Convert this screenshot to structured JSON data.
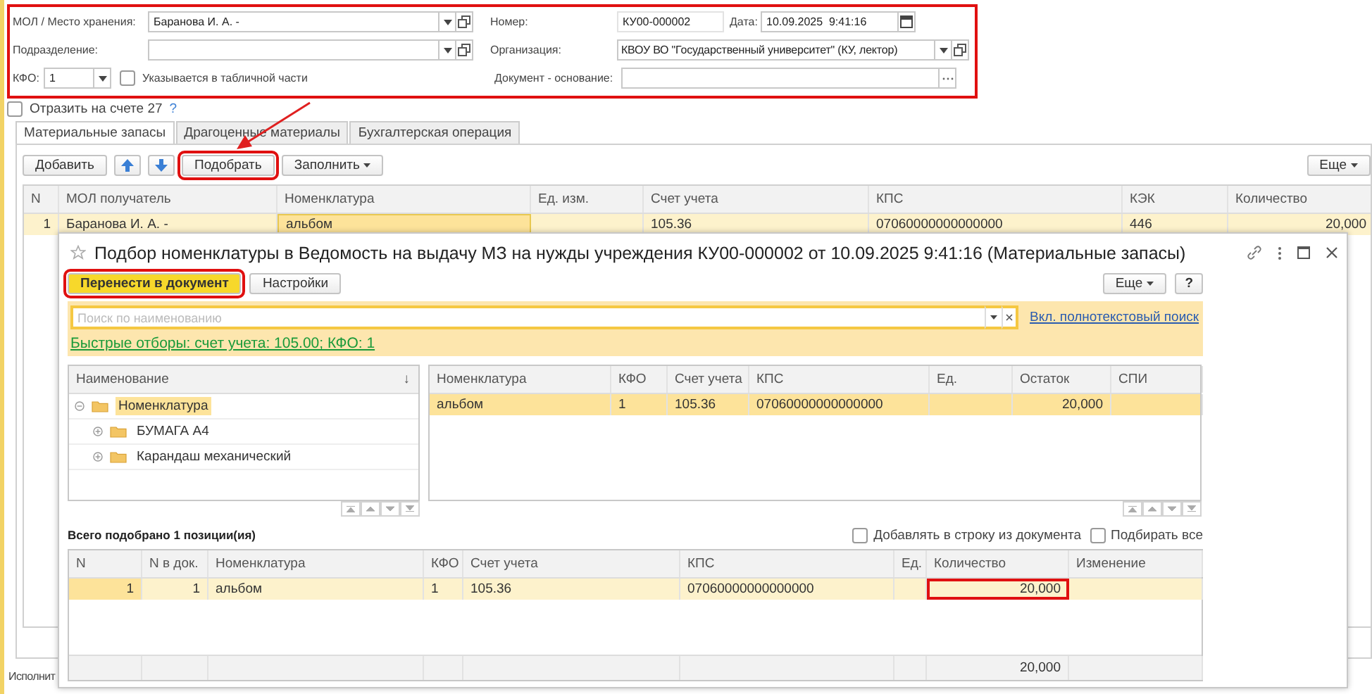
{
  "header": {
    "annotated": true,
    "mol": {
      "label": "МОЛ / Место хранения:",
      "value": "Баранова И. А. -"
    },
    "number": {
      "label": "Номер:",
      "value": "КУ00-000002"
    },
    "date": {
      "label": "Дата:",
      "value": "10.09.2025  9:41:16"
    },
    "department": {
      "label": "Подразделение:"
    },
    "organization": {
      "label": "Организация:",
      "value": "КВОУ ВО \"Государственный университет\" (КУ, лектор)"
    },
    "kfo": {
      "label": "КФО:",
      "value": "1"
    },
    "in_table": {
      "label": "Указывается в табличной части",
      "checked": false
    },
    "basis": {
      "label": "Документ - основание:"
    }
  },
  "account27": {
    "label": "Отразить на счете 27",
    "checked": false,
    "help": "?"
  },
  "tabs": [
    {
      "label": "Материальные запасы",
      "selected": true
    },
    {
      "label": "Драгоценные материалы",
      "selected": false
    },
    {
      "label": "Бухгалтерская операция",
      "selected": false
    }
  ],
  "toolbar": {
    "buttons": [
      {
        "kind": "text",
        "label": "Добавить",
        "annotated": false
      },
      {
        "kind": "up"
      },
      {
        "kind": "down"
      },
      {
        "kind": "text",
        "label": "Подобрать",
        "annotated": true
      },
      {
        "kind": "dropdown",
        "label": "Заполнить",
        "annotated": false
      }
    ],
    "more": "Еще"
  },
  "table": {
    "columns": [
      "N",
      "МОЛ получатель",
      "Номенклатура",
      "Ед. изм.",
      "Счет учета",
      "КПС",
      "КЭК",
      "Количество"
    ],
    "rows": [
      {
        "selected": true,
        "focused": [
          false,
          false,
          true,
          false,
          false,
          false,
          false,
          false
        ],
        "cells": [
          "1",
          "Баранова И. А. -",
          "альбом",
          null,
          "105.36",
          "07060000000000000",
          "446",
          "20,000"
        ]
      }
    ]
  },
  "footer_label": "Исполнит",
  "dialog": {
    "title": "Подбор номенклатуры в Ведомость на выдачу МЗ на нужды учреждения КУ00-000002 от 10.09.2025 9:41:16 (Материальные запасы)",
    "buttons": [
      {
        "label": "Перенести в документ",
        "default": true,
        "annotated": true
      },
      {
        "label": "Настройки",
        "default": false,
        "annotated": false
      }
    ],
    "more": "Еще",
    "help": "?",
    "search": {
      "placeholder": "Поиск по наименованию"
    },
    "fulltext_link": "Вкл. полнотекстовый поиск",
    "quick_filter": "Быстрые отборы: счет учета: 105.00; КФО: 1",
    "tree": {
      "column": "Наименование",
      "sort": "↓",
      "items": [
        {
          "label": "Номенклатура",
          "expanded": true,
          "selected": true,
          "children": [
            {
              "label": "БУМАГА А4",
              "expanded": false,
              "selected": false
            },
            {
              "label": "Карандаш механический",
              "expanded": false,
              "selected": false
            }
          ]
        }
      ]
    },
    "stock": {
      "columns": [
        "Номенклатура",
        "КФО",
        "Счет учета",
        "КПС",
        "Ед.",
        "Остаток",
        "СПИ"
      ],
      "rows": [
        {
          "selected": true,
          "cells": [
            "альбом",
            "1",
            "105.36",
            "07060000000000000",
            null,
            "20,000",
            null
          ]
        }
      ]
    },
    "summary": "Всего подобрано 1 позиции(ия)",
    "options": [
      {
        "label": "Добавлять в строку из документа",
        "checked": false
      },
      {
        "label": "Подбирать все",
        "checked": false
      }
    ],
    "picked": {
      "columns": [
        "N",
        "N в док.",
        "Номенклатура",
        "КФО",
        "Счет учета",
        "КПС",
        "Ед.",
        "Количество",
        "Изменение"
      ],
      "rows": [
        {
          "selected": true,
          "focused": [
            true,
            false,
            false,
            false,
            false,
            false,
            false,
            false,
            false
          ],
          "annotated": [
            false,
            false,
            false,
            false,
            false,
            false,
            false,
            true,
            false
          ],
          "cells": [
            "1",
            "1",
            "альбом",
            "1",
            "105.36",
            "07060000000000000",
            null,
            "20,000",
            null
          ]
        }
      ],
      "quantity_total": "20,000"
    }
  }
}
